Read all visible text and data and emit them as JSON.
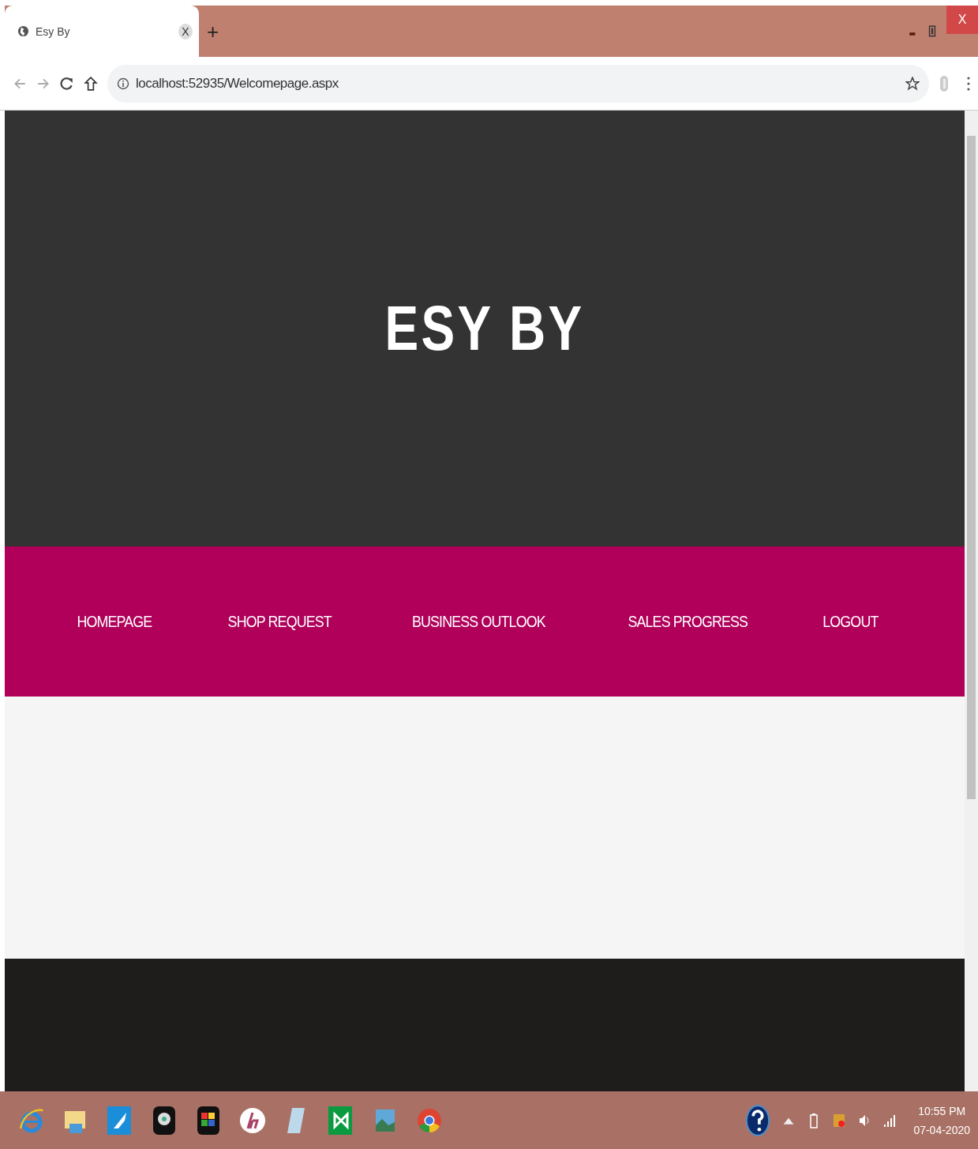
{
  "browser": {
    "tab": {
      "title": "Esy By",
      "close": "X"
    },
    "new_tab": "+",
    "window_close": "X",
    "address": "localhost:52935/Welcomepage.aspx"
  },
  "site": {
    "title": "ESY BY",
    "nav": [
      {
        "label": "HOMEPAGE"
      },
      {
        "label": "SHOP REQUEST"
      },
      {
        "label": "BUSINESS OUTLOOK"
      },
      {
        "label": "SALES PROGRESS"
      },
      {
        "label": "LOGOUT"
      }
    ]
  },
  "taskbar": {
    "time": "10:55 PM",
    "date": "07-04-2020"
  }
}
